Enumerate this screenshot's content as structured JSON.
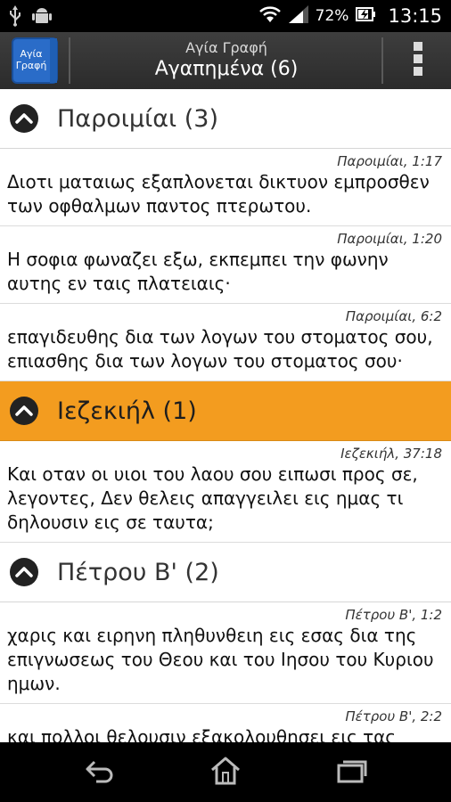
{
  "status_bar": {
    "battery_percent": "72%",
    "time": "13:15",
    "icons": [
      "usb-icon",
      "android-debug-icon",
      "wifi-icon",
      "signal-icon",
      "battery-charging-icon"
    ]
  },
  "action_bar": {
    "app_name": "Αγία Γραφή",
    "title": "Αγαπημένα (6)",
    "app_icon_text": [
      "Αγία",
      "Γραφή"
    ],
    "overflow_icon": "overflow-menu-icon"
  },
  "groups": [
    {
      "title": "Παροιμίαι (3)",
      "active": false,
      "verses": [
        {
          "ref": "Παροιμίαι, 1:17",
          "text": "Διοτι ματαιως εξαπλονεται δικτυον εμπροσθεν των οφθαλμων παντος πτερωτου."
        },
        {
          "ref": "Παροιμίαι, 1:20",
          "text": "Η σοφια φωναζει εξω, εκπεμπει την φωνην αυτης εν ταις πλατειαις·"
        },
        {
          "ref": "Παροιμίαι, 6:2",
          "text": "επαγιδευθης δια των λογων του στοματος σου, επιασθης δια των λογων του στοματος σου·"
        }
      ]
    },
    {
      "title": "Ιεζεκιήλ (1)",
      "active": true,
      "verses": [
        {
          "ref": "Ιεζεκιήλ, 37:18",
          "text": "Και οταν οι υιοι του λαου σου ειπωσι προς σε, λεγοντες, Δεν θελεις απαγγειλει εις ημας τι δηλουσιν εις σε ταυτα;"
        }
      ]
    },
    {
      "title": "Πέτρου Β' (2)",
      "active": false,
      "verses": [
        {
          "ref": "Πέτρου Β', 1:2",
          "text": "χαρις και ειρηνη πληθυνθειη εις εσας δια της επιγνωσεως του Θεου και του Ιησου του Κυριου ημων."
        },
        {
          "ref": "Πέτρου Β', 2:2",
          "text": "και πολλοι θελουσιν εξακολουθησει εις τας απωλειας αυτων, δια τους οποιους η οδος της"
        }
      ]
    }
  ],
  "nav_bar": {
    "icons": [
      "back-icon",
      "home-icon",
      "recent-apps-icon"
    ]
  },
  "colors": {
    "active_group": "#f39c1f",
    "action_bar": "#333333",
    "status_bar": "#000000",
    "app_icon": "#2a6cc8"
  }
}
